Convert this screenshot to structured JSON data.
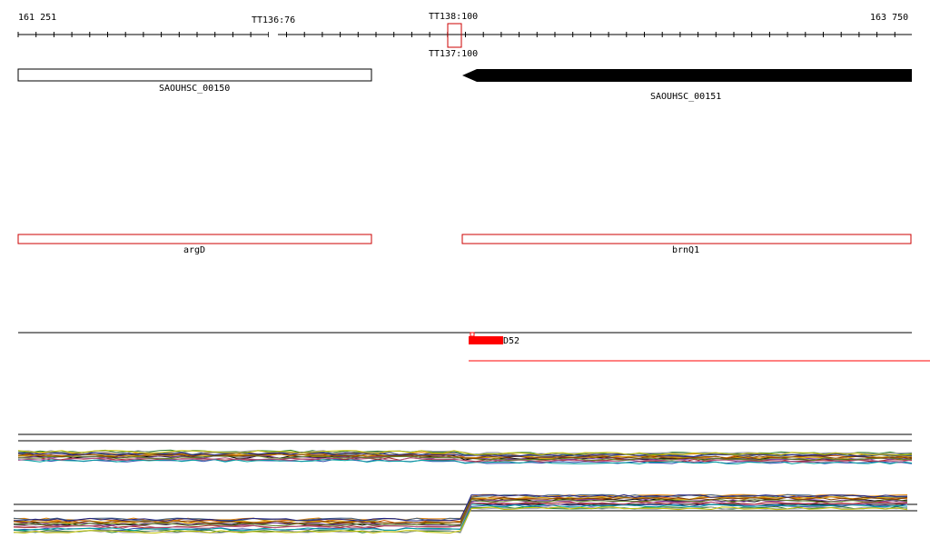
{
  "ruler": {
    "start_label": "161 251",
    "end_label": "163 750",
    "markers": [
      {
        "label": "TT136:76",
        "kind": "terminator"
      },
      {
        "label": "TT138:100",
        "kind": "terminator"
      },
      {
        "label": "TT137:100",
        "kind": "terminator"
      }
    ]
  },
  "genes": [
    {
      "label": "SAOUHSC_00150",
      "strand": "+"
    },
    {
      "label": "SAOUHSC_00151",
      "strand": "-"
    }
  ],
  "gene_names": [
    {
      "label": "argD"
    },
    {
      "label": "brnQ1"
    }
  ],
  "feature": {
    "label": "D52",
    "color": "#ff0000"
  },
  "colors": {
    "outline": "#000000",
    "highlight": "#cc0000",
    "arrow_fill": "#000000"
  }
}
